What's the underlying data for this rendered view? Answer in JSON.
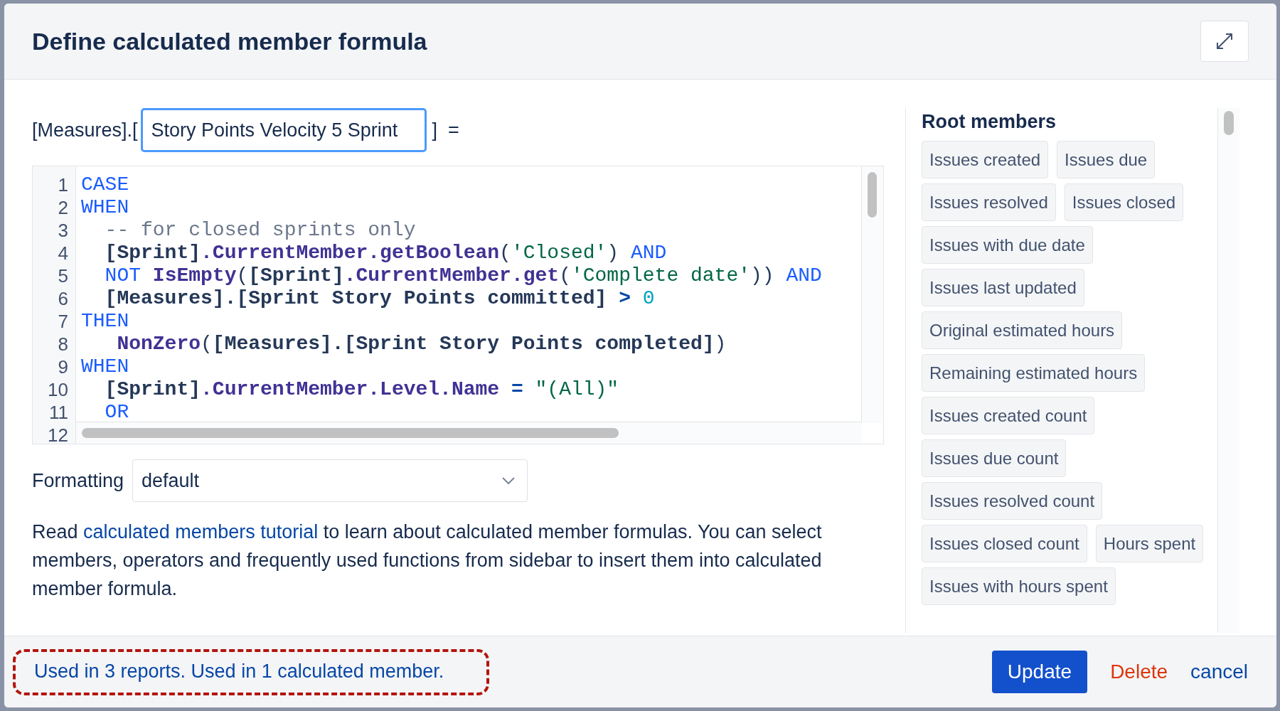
{
  "dialog": {
    "title": "Define calculated member formula"
  },
  "formula_name": {
    "prefix": "[Measures].[",
    "value": "Story Points Velocity 5 Sprint",
    "suffix": "]  ="
  },
  "editor": {
    "lines": [
      {
        "number": "1",
        "tokens": [
          {
            "kind": "keyword",
            "text": "CASE"
          }
        ]
      },
      {
        "number": "2",
        "tokens": [
          {
            "kind": "keyword",
            "text": "WHEN"
          }
        ]
      },
      {
        "number": "3",
        "tokens": [
          {
            "kind": "comment",
            "text": "  -- for closed sprints only"
          }
        ]
      },
      {
        "number": "4",
        "tokens": [
          {
            "kind": "member",
            "text": "  [Sprint]"
          },
          {
            "kind": "function",
            "text": ".CurrentMember.getBoolean"
          },
          {
            "kind": "plain",
            "text": "("
          },
          {
            "kind": "string",
            "text": "'Closed'"
          },
          {
            "kind": "plain",
            "text": ") "
          },
          {
            "kind": "keyword",
            "text": "AND"
          }
        ]
      },
      {
        "number": "5",
        "tokens": [
          {
            "kind": "keyword",
            "text": "  NOT "
          },
          {
            "kind": "function",
            "text": "IsEmpty"
          },
          {
            "kind": "plain",
            "text": "("
          },
          {
            "kind": "member",
            "text": "[Sprint]"
          },
          {
            "kind": "function",
            "text": ".CurrentMember.get"
          },
          {
            "kind": "plain",
            "text": "("
          },
          {
            "kind": "string",
            "text": "'Complete date'"
          },
          {
            "kind": "plain",
            "text": ")) "
          },
          {
            "kind": "keyword",
            "text": "AND"
          }
        ]
      },
      {
        "number": "6",
        "tokens": [
          {
            "kind": "member",
            "text": "  [Measures].[Sprint Story Points committed] "
          },
          {
            "kind": "operator",
            "text": ">"
          },
          {
            "kind": "number",
            "text": " 0"
          }
        ]
      },
      {
        "number": "7",
        "tokens": [
          {
            "kind": "keyword",
            "text": "THEN"
          }
        ]
      },
      {
        "number": "8",
        "tokens": [
          {
            "kind": "function",
            "text": "   NonZero"
          },
          {
            "kind": "plain",
            "text": "("
          },
          {
            "kind": "member",
            "text": "[Measures].[Sprint Story Points completed]"
          },
          {
            "kind": "plain",
            "text": ")"
          }
        ]
      },
      {
        "number": "9",
        "tokens": [
          {
            "kind": "keyword",
            "text": "WHEN"
          }
        ]
      },
      {
        "number": "10",
        "tokens": [
          {
            "kind": "member",
            "text": "  [Sprint]"
          },
          {
            "kind": "function",
            "text": ".CurrentMember.Level.Name"
          },
          {
            "kind": "operator",
            "text": " = "
          },
          {
            "kind": "string",
            "text": "\"(All)\""
          }
        ]
      },
      {
        "number": "11",
        "tokens": [
          {
            "kind": "keyword",
            "text": "  OR"
          }
        ]
      },
      {
        "number": "12"
      }
    ]
  },
  "formatting": {
    "label": "Formatting",
    "value": "default"
  },
  "help": {
    "before": "Read ",
    "link": "calculated members tutorial",
    "after": " to learn about calculated member formulas. You can select members, operators and frequently used functions from sidebar to insert them into calculated member formula."
  },
  "sidebar": {
    "title": "Root members",
    "members": [
      "Issues created",
      "Issues due",
      "Issues resolved",
      "Issues closed",
      "Issues with due date",
      "Issues last updated",
      "Original estimated hours",
      "Remaining estimated hours",
      "Issues created count",
      "Issues due count",
      "Issues resolved count",
      "Issues closed count",
      "Hours spent",
      "Issues with hours spent"
    ]
  },
  "footer": {
    "usage": "Used in 3 reports. Used in 1 calculated member.",
    "highlighted": true,
    "buttons": [
      {
        "kind": "primary",
        "label": "Update"
      },
      {
        "kind": "danger",
        "label": "Delete"
      },
      {
        "kind": "link",
        "label": "cancel"
      }
    ]
  }
}
